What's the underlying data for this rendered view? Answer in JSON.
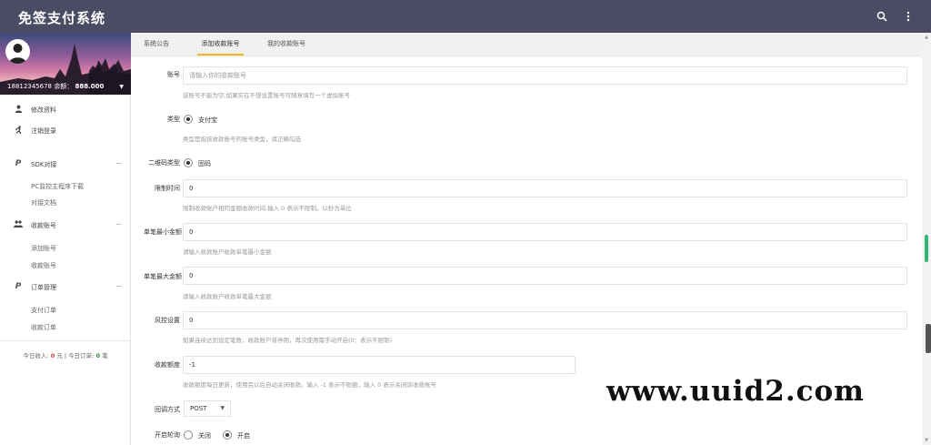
{
  "app": {
    "title": "免签支付系统"
  },
  "topbar": {
    "search_icon": "search-icon",
    "more_icon": "more-vert-icon"
  },
  "profile": {
    "account": "18812345678",
    "balance_label": "余额：",
    "balance": "888.000"
  },
  "nav": {
    "edit_profile": "修改资料",
    "logout": "注销登录",
    "sdk": "SDK对接",
    "sdk_download": "PC监控主程序下载",
    "sdk_docs": "对接文档",
    "accounts": "收款账号",
    "add_account": "添加账号",
    "account_list": "收款账号",
    "orders": "订单管理",
    "pay_orders": "支付订单",
    "receive_orders": "收款订单",
    "collapse_symbol": "−"
  },
  "today": {
    "income_label": "今日收入:",
    "income_value": "0",
    "income_unit": "元",
    "separator": "|",
    "orders_label": "今日订单:",
    "orders_value": "0",
    "orders_unit": "笔"
  },
  "tabs": [
    {
      "label": "系统公告"
    },
    {
      "label": "添加收款账号"
    },
    {
      "label": "我的收款账号"
    }
  ],
  "form": {
    "account": {
      "label": "账号",
      "placeholder": "请输入你的收款账号",
      "hint": "该账号不能为空,如果实在不想设置账号可随意填写一个虚拟账号"
    },
    "type": {
      "label": "类型",
      "option": "支付宝",
      "hint": "类型是指该收款账号的账号类型，请正确勾选"
    },
    "qr_type": {
      "label": "二维码类型",
      "option": "固码"
    },
    "time_limit": {
      "label": "限制时间",
      "value": "0",
      "hint": "限制收款账户相同金额收款时间,输入 0 表示不限制。以秒为单位"
    },
    "min_amount": {
      "label": "单笔最小金额",
      "value": "0",
      "hint": "请输入收款账户收款单笔最小金额"
    },
    "max_amount": {
      "label": "单笔最大金额",
      "value": "0",
      "hint": "请输入收款账户收款单笔最大金额"
    },
    "risk": {
      "label": "风控设置",
      "value": "0",
      "hint": "如果连续达到设定笔数，收款账户将停用，再次使用需手动开启(0：表示不限制)"
    },
    "quota": {
      "label": "收款额度",
      "value": "-1",
      "hint": "收款额度每日更新，使用完以后自动关闭收款。输入 -1 表示不限额，输入 0 表示关闭该收款账号"
    },
    "callback": {
      "label": "回调方式",
      "value": "POST"
    },
    "polling": {
      "label": "开启轮询",
      "off": "关闭",
      "on": "开启"
    }
  },
  "watermark": "www.uuid2.com"
}
